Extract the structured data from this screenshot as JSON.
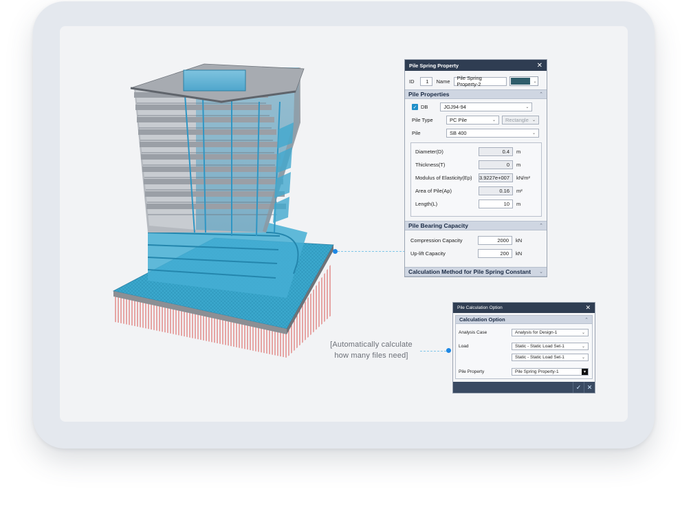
{
  "colors": {
    "accent": "#1e88e5",
    "titlebar": "#2f3d52",
    "section": "#cfd6e2",
    "pile_red": "#d9534f",
    "slab_cyan": "#3aa9cf",
    "swatch": "#2f5d6b"
  },
  "pile_spring": {
    "title": "Pile Spring Property",
    "id_label": "ID",
    "id_value": "1",
    "name_label": "Name",
    "name_value": "Pile Spring Property-2",
    "section_properties": "Pile Properties",
    "db_label": "DB",
    "db_value": "JGJ94-94",
    "pile_type_label": "Pile Type",
    "pile_type_value": "PC Pile",
    "shape_value": "Rectangle",
    "pile_label": "Pile",
    "pile_value": "SB 400",
    "props": [
      {
        "label": "Diameter(D)",
        "value": "0.4",
        "unit": "m"
      },
      {
        "label": "Thickness(T)",
        "value": "0",
        "unit": "m"
      },
      {
        "label": "Modulus of Elasticity(Ep)",
        "value": "3.9227e+007",
        "unit": "kN/m²"
      },
      {
        "label": "Area of Pile(Ap)",
        "value": "0.16",
        "unit": "m²"
      },
      {
        "label": "Length(L)",
        "value": "10",
        "unit": "m"
      }
    ],
    "section_bearing": "Pile Bearing Capacity",
    "compression_label": "Compression Capacity",
    "compression_value": "2000",
    "compression_unit": "kN",
    "uplift_label": "Up-lift Capacity",
    "uplift_value": "200",
    "uplift_unit": "kN",
    "section_calc": "Calculation Method for Pile Spring Constant"
  },
  "calc_option": {
    "title": "Pile Calculation Option",
    "section": "Calculation Option",
    "analysis_case_label": "Analysis Case",
    "analysis_case_value": "Analysis for Design-1",
    "load_label": "Load",
    "load_value_1": "Static - Static Load Set-1",
    "load_value_2": "Static - Static Load Set-1",
    "pile_property_label": "Pile Property",
    "pile_property_value": "Pile Spring Property-1"
  },
  "caption": {
    "line1": "[Automatically calculate",
    "line2": "how many files need]"
  }
}
